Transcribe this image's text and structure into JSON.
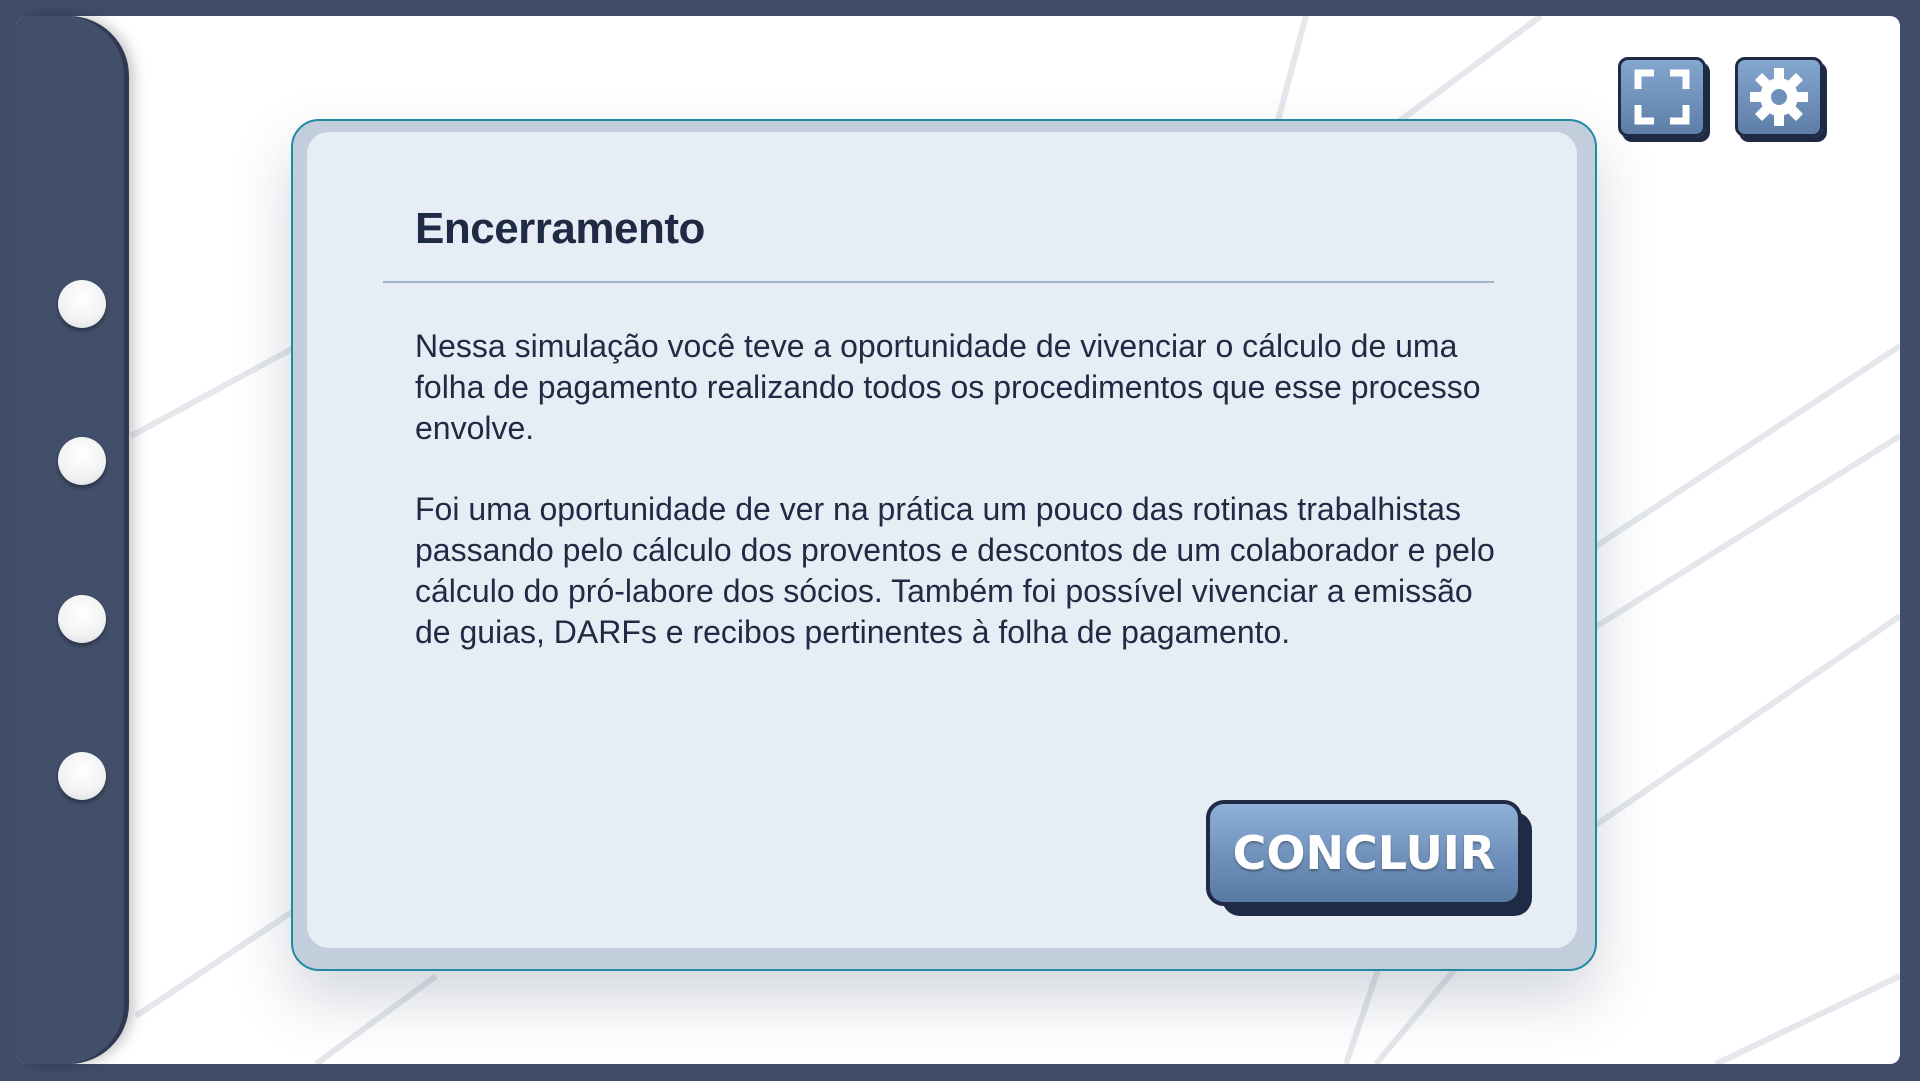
{
  "toolbar": {
    "fullscreen_icon": "fullscreen-icon",
    "settings_icon": "gear-icon"
  },
  "binder": {
    "rings": [
      "ring",
      "ring",
      "ring",
      "ring"
    ]
  },
  "dialog": {
    "title": "Encerramento",
    "paragraphs": [
      "Nessa simulação você teve a oportunidade de vivenciar o cálculo de uma folha de pagamento realizando todos os procedimentos que esse processo envolve.",
      "Foi uma oportunidade de ver na prática um pouco das rotinas trabalhistas passando pelo cálculo dos proventos e descontos de um colaborador e pelo cálculo do pró-labore dos sócios. Também foi possível vivenciar a emissão de guias, DARFs e recibos pertinentes à folha de pagamento."
    ],
    "conclude_label": "CONCLUIR"
  },
  "colors": {
    "frame": "#3f4d68",
    "dark_navy": "#1f2a44",
    "button_blue": "#6f90ba",
    "dialog_bg": "#e6edf4",
    "accent_border": "#1f8aa0"
  }
}
